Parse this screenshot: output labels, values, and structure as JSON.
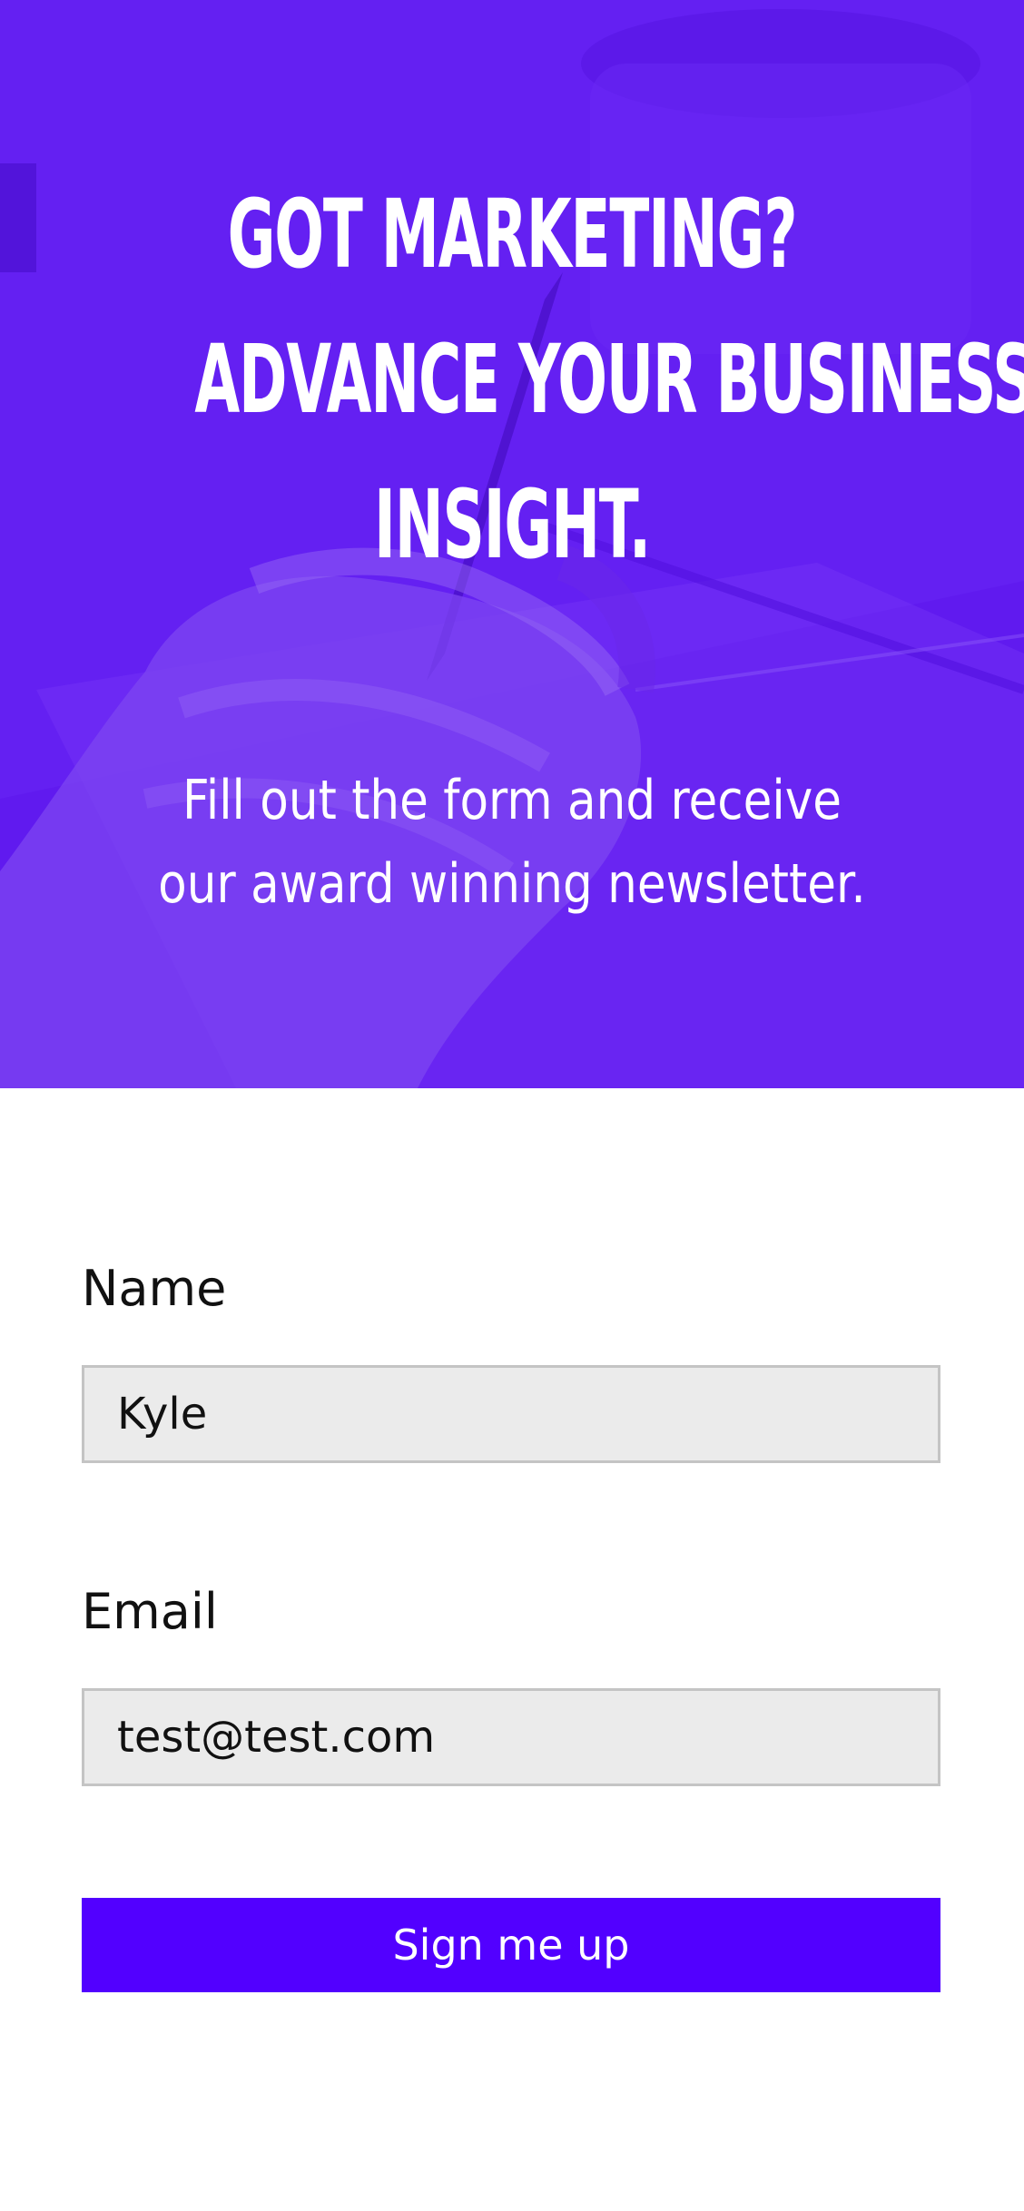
{
  "hero": {
    "title_lines": [
      "Got marketing?",
      "Advance your business",
      "insight."
    ],
    "subtitle_lines": [
      "Fill out the form and receive",
      "our award winning newsletter."
    ],
    "overlay_color": "#6420f2"
  },
  "form": {
    "name": {
      "label": "Name",
      "value": "Kyle"
    },
    "email": {
      "label": "Email",
      "value": "test@test.com"
    },
    "submit_label": "Sign me up",
    "button_color": "#5200ff"
  }
}
